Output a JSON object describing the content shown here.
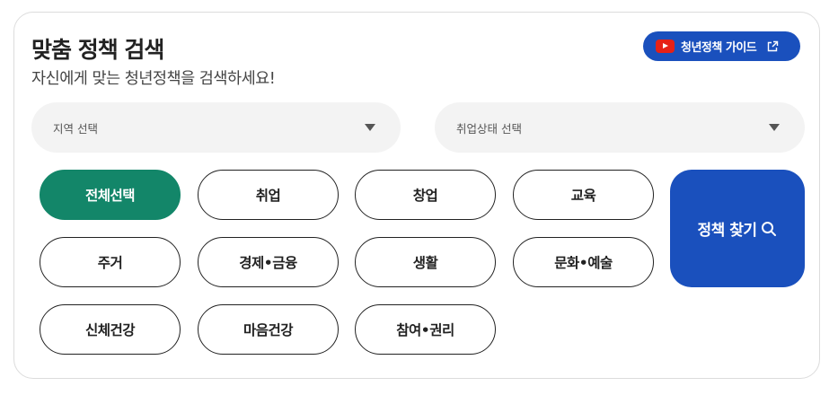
{
  "header": {
    "title": "맞춤 정책 검색",
    "subtitle": "자신에게 맞는 청년정책을 검색하세요!",
    "guide_label": "청년정책 가이드"
  },
  "filters": {
    "region_placeholder": "지역 선택",
    "status_placeholder": "취업상태 선택"
  },
  "categories": [
    {
      "label": "전체선택",
      "selected": true
    },
    {
      "label": "취업",
      "selected": false
    },
    {
      "label": "창업",
      "selected": false
    },
    {
      "label": "교육",
      "selected": false
    },
    {
      "label": "주거",
      "selected": false
    },
    {
      "label": "경제•금융",
      "selected": false
    },
    {
      "label": "생활",
      "selected": false
    },
    {
      "label": "문화•예술",
      "selected": false
    },
    {
      "label": "신체건강",
      "selected": false
    },
    {
      "label": "마음건강",
      "selected": false
    },
    {
      "label": "참여•권리",
      "selected": false
    }
  ],
  "search_label": "정책 찾기",
  "icons": [
    "youtube-icon",
    "external-link-icon",
    "caret-down-icon",
    "search-icon"
  ],
  "colors": {
    "primary_blue": "#1a50bd",
    "active_green": "#138669",
    "youtube_red": "#e62117"
  }
}
